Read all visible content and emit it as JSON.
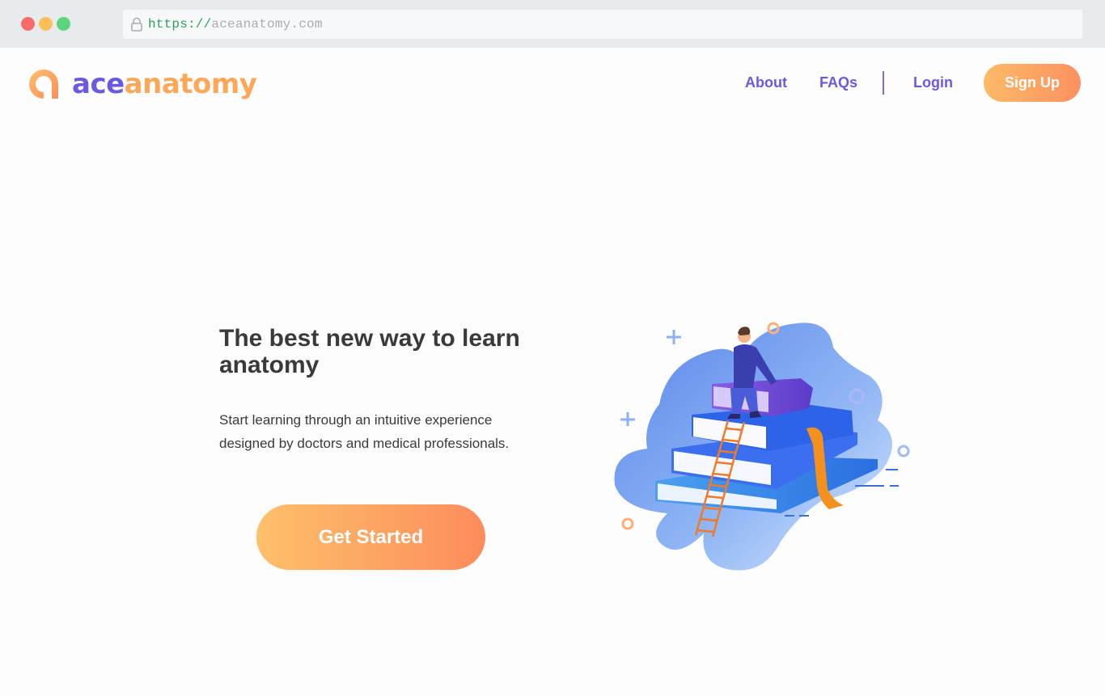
{
  "browser": {
    "url_scheme": "https://",
    "url_host": "aceanatomy.com"
  },
  "header": {
    "logo_part1": "ace",
    "logo_part2": "anatomy",
    "nav": {
      "about": "About",
      "faqs": "FAQs",
      "login": "Login",
      "signup": "Sign Up"
    }
  },
  "hero": {
    "title": "The best new way to learn anatomy",
    "subtitle": "Start learning through an intuitive experience designed by doctors and medical professionals.",
    "cta": "Get Started"
  },
  "colors": {
    "brand_purple": "#6a5ae0",
    "brand_orange": "#fca858",
    "button_gradient_start": "#fdc06a",
    "button_gradient_end": "#fd8c5c"
  }
}
